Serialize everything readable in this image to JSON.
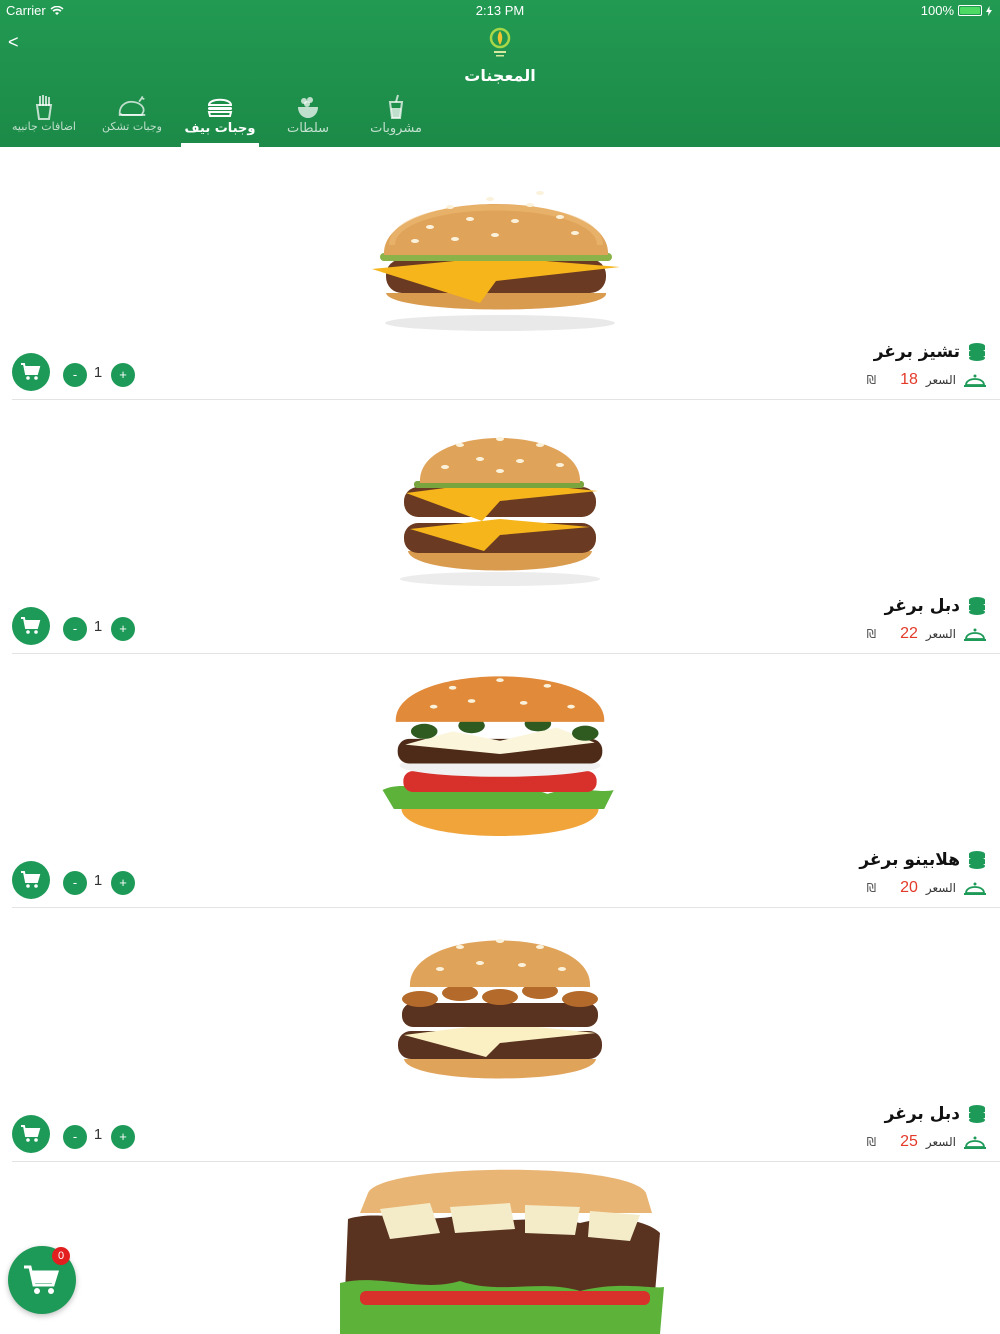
{
  "status_bar": {
    "carrier": "Carrier",
    "time": "2:13 PM",
    "battery": "100%"
  },
  "header": {
    "back": "<",
    "title": "المعجنات"
  },
  "tabs": [
    {
      "label": "اضافات جانبيه",
      "icon": "fries-icon"
    },
    {
      "label": "وجبات تشكن",
      "icon": "chicken-icon"
    },
    {
      "label": "وجبات بيف",
      "icon": "burger-icon",
      "active": true
    },
    {
      "label": "سلطات",
      "icon": "salad-icon"
    },
    {
      "label": "مشروبات",
      "icon": "drink-icon"
    }
  ],
  "price_label": "السعر",
  "currency": "₪",
  "items": [
    {
      "name": "تشيز برغر",
      "price": "18",
      "qty": "1",
      "image": "cheeseburger"
    },
    {
      "name": "دبل برغر",
      "price": "22",
      "qty": "1",
      "image": "double-burger"
    },
    {
      "name": "هلابينو برغر",
      "price": "20",
      "qty": "1",
      "image": "jalapeno-burger"
    },
    {
      "name": "دبل برغر",
      "price": "25",
      "qty": "1",
      "image": "mushroom-burger"
    }
  ],
  "cart": {
    "count": "0"
  },
  "colors": {
    "primary": "#1e9a58",
    "price": "#e33a2a",
    "badge": "#e31e1e"
  }
}
